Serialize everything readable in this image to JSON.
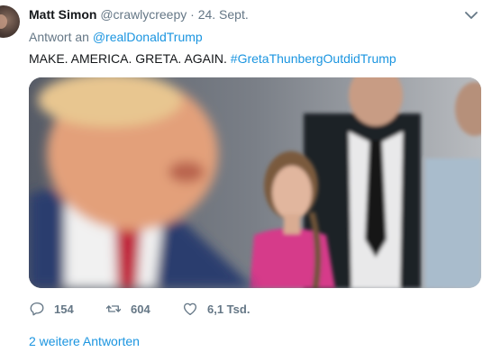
{
  "tweet": {
    "author_name": "Matt Simon",
    "handle": "@crawlycreepy",
    "separator": "·",
    "date": "24. Sept.",
    "reply_prefix": "Antwort an",
    "reply_to": "@realDonaldTrump",
    "text": "MAKE. AMERICA. GRETA. AGAIN.",
    "hashtag": "#GretaThunbergOutdidTrump",
    "icons": {
      "menu": "chevron-down-icon",
      "reply": "reply-icon",
      "retweet": "retweet-icon",
      "like": "heart-icon"
    }
  },
  "actions": {
    "replies": "154",
    "retweets": "604",
    "likes": "6,1 Tsd."
  },
  "thread": {
    "more_replies": "2 weitere Antworten"
  },
  "colors": {
    "link": "#1b95e0",
    "muted": "#657786",
    "text": "#14171a"
  }
}
